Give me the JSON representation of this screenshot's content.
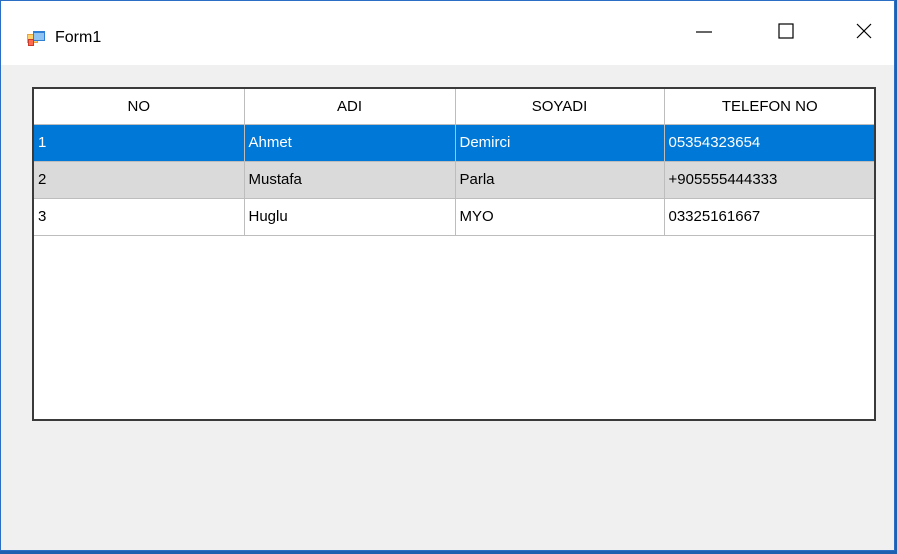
{
  "window": {
    "title": "Form1",
    "icon": "winforms-app-icon",
    "controls": {
      "minimize": "minimize-icon",
      "maximize": "maximize-icon",
      "close": "close-icon"
    }
  },
  "grid": {
    "columns": [
      "NO",
      "ADI",
      "SOYADI",
      "TELEFON NO"
    ],
    "rows": [
      {
        "no": "1",
        "adi": "Ahmet",
        "soyadi": "Demirci",
        "telefon": "05354323654",
        "selected": true
      },
      {
        "no": "2",
        "adi": "Mustafa",
        "soyadi": "Parla",
        "telefon": "+905555444333",
        "selected": false
      },
      {
        "no": "3",
        "adi": "Huglu",
        "soyadi": "MYO",
        "telefon": "03325161667",
        "selected": false
      }
    ],
    "colors": {
      "selection": "#0078d7",
      "alternate_row": "#dadada"
    }
  }
}
